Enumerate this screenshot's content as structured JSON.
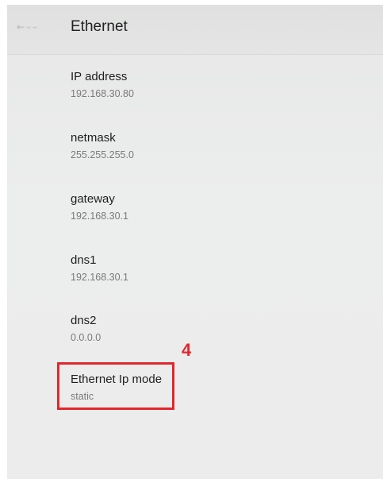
{
  "header": {
    "title": "Ethernet"
  },
  "settings": [
    {
      "label": "IP address",
      "value": "192.168.30.80"
    },
    {
      "label": "netmask",
      "value": "255.255.255.0"
    },
    {
      "label": "gateway",
      "value": "192.168.30.1"
    },
    {
      "label": "dns1",
      "value": "192.168.30.1"
    },
    {
      "label": "dns2",
      "value": "0.0.0.0"
    },
    {
      "label": "Ethernet Ip mode",
      "value": "static"
    }
  ],
  "annotation": {
    "step_number": "4",
    "highlight_color": "#e3262b"
  },
  "icons": {
    "back": "back-arrow-icon"
  }
}
